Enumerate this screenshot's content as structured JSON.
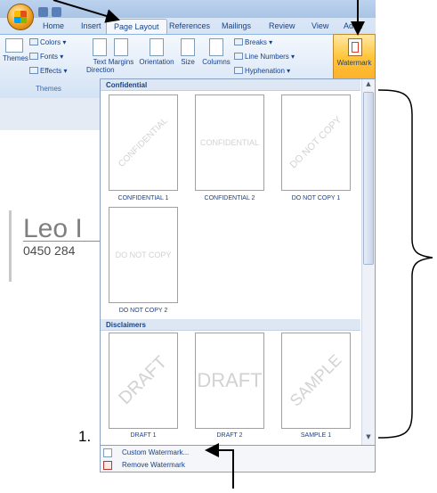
{
  "ribbon": {
    "tabs": [
      "Home",
      "Insert",
      "Page Layout",
      "References",
      "Mailings",
      "Review",
      "View",
      "Add-I"
    ],
    "active_tab": "Page Layout",
    "themes_group": {
      "label": "Themes",
      "themes_button": "Themes",
      "colors": "Colors",
      "fonts": "Fonts",
      "effects": "Effects"
    },
    "page_setup": {
      "text_direction": "Text\nDirection",
      "margins": "Margins",
      "orientation": "Orientation",
      "size": "Size",
      "columns": "Columns"
    },
    "small_items": {
      "breaks": "Breaks",
      "line_numbers": "Line Numbers",
      "hyphenation": "Hyphenation"
    },
    "watermark": "Watermark",
    "accent": "#15428b",
    "active_color": "#ffc63a"
  },
  "document": {
    "name": "Leo I",
    "phone": "0450 284"
  },
  "gallery": {
    "categories": [
      "Confidential",
      "Disclaimers"
    ],
    "confidential": [
      {
        "caption": "CONFIDENTIAL 1",
        "mark": "CONFIDENTIAL",
        "diagonal": true
      },
      {
        "caption": "CONFIDENTIAL 2",
        "mark": "CONFIDENTIAL",
        "diagonal": false
      },
      {
        "caption": "DO NOT COPY 1",
        "mark": "DO NOT COPY",
        "diagonal": true
      },
      {
        "caption": "DO NOT COPY 2",
        "mark": "DO NOT COPY",
        "diagonal": false
      }
    ],
    "disclaimers": [
      {
        "caption": "DRAFT 1",
        "mark": "DRAFT",
        "diagonal": true
      },
      {
        "caption": "DRAFT 2",
        "mark": "DRAFT",
        "diagonal": false
      },
      {
        "caption": "SAMPLE 1",
        "mark": "SAMPLE",
        "diagonal": true
      }
    ]
  },
  "menu": {
    "custom_watermark": "Custom Watermark...",
    "remove_watermark": "Remove Watermark"
  },
  "annotation": {
    "step": "1."
  }
}
